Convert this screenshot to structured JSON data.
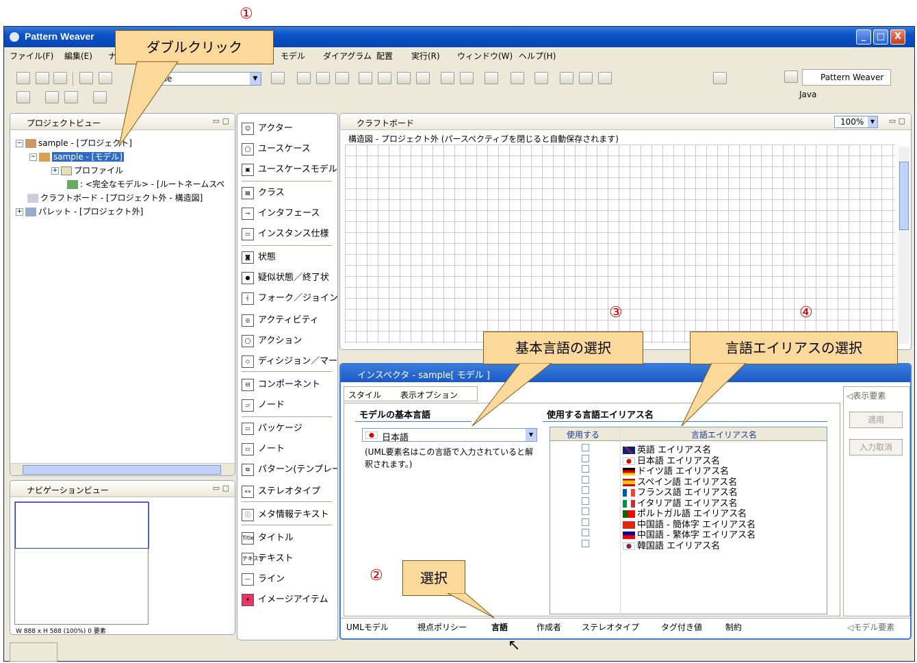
{
  "window": {
    "title": "Pattern Weaver",
    "controls": [
      "_",
      "□",
      "X"
    ]
  },
  "menu": [
    "ファイル(F)",
    "編集(E)",
    "モデル",
    "ダイアグラム",
    "配置",
    "実行(R)",
    "ウィンドウ(W)",
    "ヘルプ(H)"
  ],
  "menu_partial": "ナ",
  "toolbar": {
    "combo_value": "ple",
    "perspective_active": "Pattern Weaver",
    "perspective_java": "Java"
  },
  "annotations": {
    "circle1": "①",
    "circle2": "②",
    "circle3": "③",
    "circle4": "④",
    "callout_dblclick": "ダブルクリック",
    "callout_select": "選択",
    "callout_base_lang": "基本言語の選択",
    "callout_alias": "言語エイリアスの選択"
  },
  "project_view": {
    "title": "プロジェクトビュー",
    "items": [
      "sample - [プロジェクト]",
      "sample - [モデル]",
      "プロファイル",
      ": <完全なモデル> - [ルートネームスペ",
      "クラフトボード - [プロジェクト外 - 構造図]",
      "パレット - [プロジェクト外]"
    ]
  },
  "nav_view": {
    "title": "ナビゲーションビュー",
    "status": "W 888 x H 588  (100%)     0 要素"
  },
  "palette": [
    "アクター",
    "ユースケース",
    "ユースケースモデル",
    "クラス",
    "インタフェース",
    "インスタンス仕様",
    "状態",
    "疑似状態／終了状",
    "フォーク／ジョインノ",
    "アクティビティ",
    "アクション",
    "ディシジョン／マージ",
    "コンポーネント",
    "ノード",
    "パッケージ",
    "ノート",
    "パターン(テンプレー",
    "ステレオタイプ",
    "メタ情報テキスト",
    "タイトル",
    "テキスト",
    "ライン",
    "イメージアイテム"
  ],
  "palette_icons": [
    "Title",
    "テキスト"
  ],
  "craftboard": {
    "title": "クラフトボード",
    "zoom": "100%",
    "subtitle": "構造図 - プロジェクト外 (パースペクティブを閉じると自動保存されます)"
  },
  "inspector": {
    "title": "インスペクタ - sample[ モデル ]",
    "tabs": [
      "スタイル",
      "表示オプション"
    ],
    "side_top": "◁表示要素",
    "side_bottom": "◁モデル要素",
    "apply": "適用",
    "cancel": "入力取消",
    "base_lang_header": "モデルの基本言語",
    "base_lang_value": "日本語",
    "base_lang_note": "(UML要素名はこの言語で入力されていると解釈されます。)",
    "alias_header": "使用する言語エイリアス名",
    "col_use": "使用する",
    "col_alias": "言語エイリアス名",
    "aliases": [
      "英語 エイリアス名",
      "日本語 エイリアス名",
      "ドイツ語 エイリアス名",
      "スペイン語 エイリアス名",
      "フランス語 エイリアス名",
      "イタリア語 エイリアス名",
      "ポルトガル語 エイリアス名",
      "中国語 - 簡体字 エイリアス名",
      "中国語 - 繁体字 エイリアス名",
      "韓国語 エイリアス名"
    ],
    "bottom_tabs": [
      "UMLモデル",
      "視点ポリシー",
      "言語",
      "作成者",
      "ステレオタイプ",
      "タグ付き値",
      "制約"
    ]
  }
}
